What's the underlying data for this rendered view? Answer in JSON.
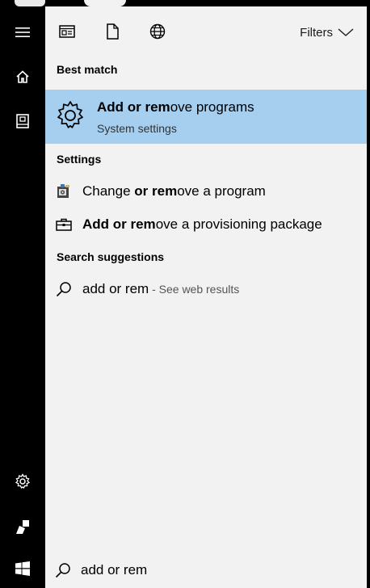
{
  "toolbar": {
    "filters_label": "Filters"
  },
  "sections": {
    "best_match": "Best match",
    "settings": "Settings",
    "search_suggestions": "Search suggestions"
  },
  "best_match": {
    "title_bold": "Add or rem",
    "title_rest": "ove programs",
    "subtitle": "System settings"
  },
  "settings_items": [
    {
      "pre": "Change ",
      "bold": "or rem",
      "rest": "ove a program"
    },
    {
      "pre": "",
      "bold": "Add or rem",
      "rest": "ove a provisioning package"
    }
  ],
  "suggestion": {
    "text": "add or rem",
    "hint": " - See web results"
  },
  "search": {
    "value": "add or rem"
  },
  "colors": {
    "highlight": "#a6cfef",
    "panel": "#f2f2f2",
    "rail": "#000000"
  },
  "icons": {
    "rail": [
      "hamburger-icon",
      "home-icon",
      "documents-icon",
      "settings-icon",
      "user-icon",
      "windows-logo-icon"
    ],
    "toolbar": [
      "apps-icon",
      "documents-icon",
      "web-icon",
      "chevron-down-icon"
    ]
  }
}
